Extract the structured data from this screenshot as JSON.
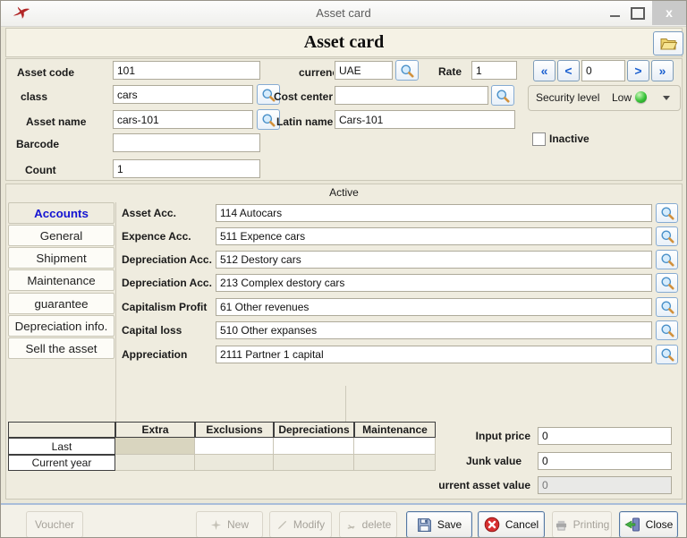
{
  "window": {
    "title": "Asset card",
    "controls": {
      "close_glyph": "x"
    }
  },
  "header": {
    "title": "Asset card"
  },
  "top_form": {
    "asset_code": {
      "label": "Asset code",
      "value": "101"
    },
    "class": {
      "label": "class",
      "value": "cars"
    },
    "asset_name": {
      "label": "Asset name",
      "value": "cars-101"
    },
    "barcode": {
      "label": "Barcode",
      "value": ""
    },
    "count": {
      "label": "Count",
      "value": "1"
    },
    "currency": {
      "label": "currenc",
      "value": "UAE"
    },
    "rate": {
      "label": "Rate",
      "value": "1"
    },
    "cost_center": {
      "label": "Cost center",
      "value": ""
    },
    "latin_name": {
      "label": "Latin name",
      "value": "Cars-101"
    },
    "navigator": {
      "first": "«",
      "prev": "<",
      "value": "0",
      "next": ">",
      "last": "»"
    },
    "security": {
      "label": "Security level",
      "value": "Low"
    },
    "inactive": {
      "label": "Inactive",
      "checked": false
    }
  },
  "accounts_panel": {
    "status": "Active",
    "tabs": [
      {
        "label": "Accounts"
      },
      {
        "label": "General"
      },
      {
        "label": "Shipment"
      },
      {
        "label": "Maintenance"
      },
      {
        "label": "guarantee"
      },
      {
        "label": "Depreciation info."
      },
      {
        "label": "Sell the asset"
      }
    ],
    "rows": [
      {
        "label": "Asset Acc.",
        "value": "114 Autocars"
      },
      {
        "label": "Expence Acc.",
        "value": "511 Expence cars"
      },
      {
        "label": "Depreciation Acc.",
        "value": "512 Destory cars"
      },
      {
        "label": "Depreciation Acc.",
        "value": "213 Complex destory cars"
      },
      {
        "label": "Capitalism Profit",
        "value": "61 Other revenues"
      },
      {
        "label": "Capital loss",
        "value": "510 Other expanses"
      },
      {
        "label": "Appreciation",
        "value": "2111 Partner 1 capital"
      }
    ]
  },
  "summary_table": {
    "columns": [
      "Extra",
      "Exclusions",
      "Depreciations",
      "Maintenance"
    ],
    "row_labels": [
      "Last",
      "Current year"
    ]
  },
  "values_panel": {
    "input_price": {
      "label": "Input price",
      "value": "0"
    },
    "junk_value": {
      "label": "Junk value",
      "value": "0"
    },
    "current_asset_value": {
      "label": "urrent asset value",
      "value": "0"
    }
  },
  "actions": {
    "voucher": "Voucher",
    "new": "New",
    "modify": "Modify",
    "delete": "delete",
    "save": "Save",
    "cancel": "Cancel",
    "printing": "Printing",
    "close": "Close"
  }
}
